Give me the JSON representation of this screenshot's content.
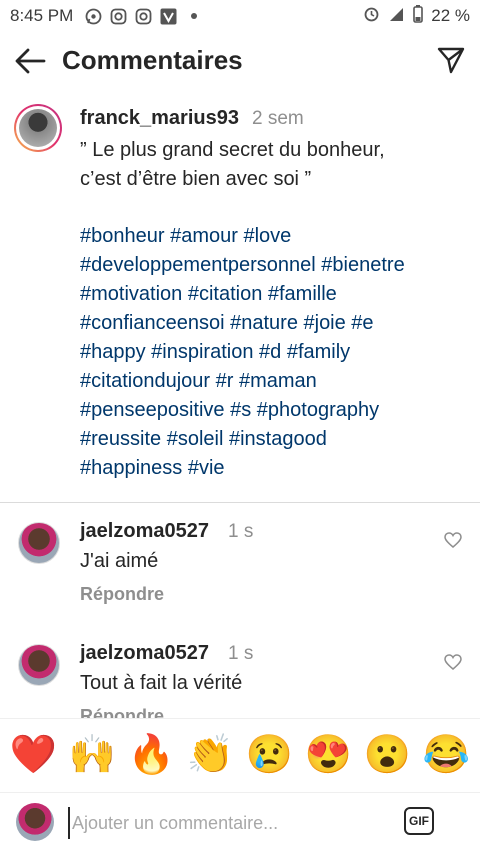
{
  "status_bar": {
    "time": "8:45 PM",
    "battery": "22 %",
    "left_icons": [
      "whatsapp-icon",
      "instagram-icon",
      "instagram-icon",
      "vpn-icon",
      "dot-icon"
    ],
    "right_icons": [
      "alarm-icon",
      "signal-icon",
      "battery-icon"
    ]
  },
  "header": {
    "title": "Commentaires"
  },
  "caption": {
    "username": "franck_marius93",
    "time": "2 sem",
    "text": "” Le plus grand secret du bonheur,\nc’est d’être bien avec soi ”",
    "hashtag_lines": [
      "#bonheur #amour #love",
      "#developpementpersonnel #bienetre",
      "#motivation #citation #famille",
      "#confianceensoi #nature #joie #e",
      "#happy #inspiration #d #family",
      "#citationdujour #r #maman",
      "#penseepositive #s #photography",
      "#reussite #soleil #instagood",
      "#happiness #vie"
    ]
  },
  "comments": [
    {
      "username": "jaelzoma0527",
      "time": "1 s",
      "text": "J'ai aimé",
      "reply_label": "Répondre"
    },
    {
      "username": "jaelzoma0527",
      "time": "1 s",
      "text": "Tout à fait la vérité",
      "reply_label": "Répondre"
    }
  ],
  "emoji_bar": [
    "❤️",
    "🙌",
    "🔥",
    "👏",
    "😢",
    "😍",
    "😮",
    "😂"
  ],
  "input": {
    "placeholder": "Ajouter un commentaire...",
    "value": "",
    "gif_label": "GIF"
  },
  "colors": {
    "hashtag": "#00376b",
    "muted": "#8e8e8e",
    "text": "#262626"
  }
}
